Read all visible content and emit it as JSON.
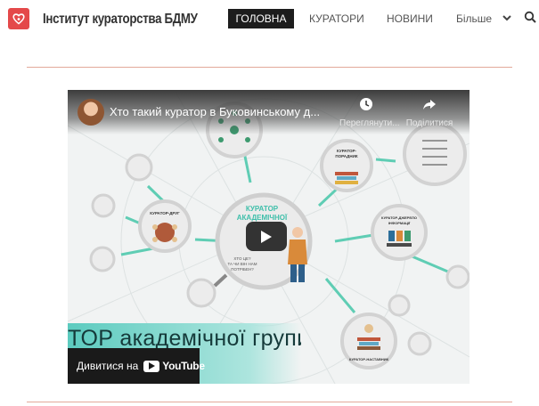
{
  "header": {
    "site_title": "Інститут кураторства БДМУ",
    "nav": {
      "home": "ГОЛОВНА",
      "curators": "КУРАТОРИ",
      "news": "НОВИНИ",
      "more": "Більше"
    }
  },
  "video": {
    "title": "Хто такий куратор в Буковинському д...",
    "watch_later": "Переглянути...",
    "share": "Поділитися",
    "banner_text": "ТОР академічної групи",
    "watch_on": "Дивитися на",
    "platform": "YouTube",
    "slide": {
      "center_title_1": "КУРАТОР",
      "center_title_2": "АКАДЕМІЧНОЇ",
      "center_sub_1": "ХТО ЦЕ?",
      "center_sub_2": "ТА ЧИ ВІН НАМ",
      "center_sub_3": "ПОТРІБЕН?",
      "node_friend": "КУРАТОР-ДРУГ",
      "node_advisor_1": "КУРАТОР-",
      "node_advisor_2": "ПОРАДНИК",
      "node_info_1": "КУРАТОР-ДЖЕРЕЛО",
      "node_info_2": "ІНФОРМАЦІЇ",
      "node_mentor": "КУРАТОР-НАСТАВНИК"
    }
  },
  "colors": {
    "brand_red": "#e4494a",
    "nav_active_bg": "#1d1d1d",
    "divider": "#e3a99a",
    "teal": "#5ccbbf"
  }
}
